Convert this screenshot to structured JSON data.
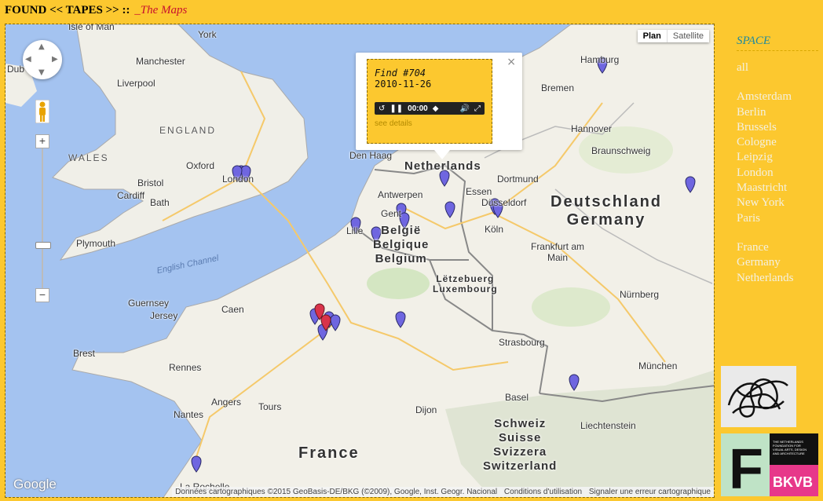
{
  "header": {
    "title": "FOUND << TAPES >> ::",
    "subtitle": "_The Maps"
  },
  "map": {
    "type_buttons": [
      {
        "label": "Plan",
        "active": true
      },
      {
        "label": "Satellite",
        "active": false
      }
    ],
    "countries": {
      "england": "ENGLAND",
      "wales": "WALES",
      "netherlands": "Netherlands",
      "belgium": [
        "België",
        "Belgique",
        "Belgium"
      ],
      "germany": [
        "Deutschland",
        "Germany"
      ],
      "luxembourg": [
        "Lëtzebuerg",
        "Luxembourg"
      ],
      "france": "France",
      "switzerland": [
        "Schweiz",
        "Suisse",
        "Svizzera",
        "Switzerland"
      ],
      "liechtenstein": "Liechtenstein"
    },
    "sea": "English Channel",
    "cities": [
      "York",
      "Isle of Man",
      "Manchester",
      "Liverpool",
      "Dub",
      "Oxford",
      "London",
      "Bristol",
      "Cardiff",
      "Bath",
      "Plymouth",
      "Guernsey",
      "Jersey",
      "Caen",
      "Brest",
      "Rennes",
      "Angers",
      "Tours",
      "Nantes",
      "La Rochelle",
      "Dijon",
      "Strasbourg",
      "Basel",
      "Nürnberg",
      "München",
      "Frankfurt am Main",
      "Köln",
      "Düsseldorf",
      "Essen",
      "Dortmund",
      "Hannover",
      "Braunschweig",
      "Bremen",
      "Hamburg",
      "Antwerpen",
      "Gent",
      "Lille",
      "Den Haag"
    ],
    "google_logo": "Google",
    "attribution": [
      "Données cartographiques ©2015 GeoBasis-DE/BKG (©2009), Google, Inst. Geogr. Nacional",
      "Conditions d'utilisation",
      "Signaler une erreur cartographique"
    ],
    "zoom_in": "+",
    "zoom_out": "−"
  },
  "popup": {
    "title": "Find #704",
    "date": "2010-11-26",
    "time": "00:00",
    "link": "see details",
    "close": "×"
  },
  "sidebar": {
    "heading": "SPACE",
    "all": "all",
    "cities": [
      "Amsterdam",
      "Berlin",
      "Brussels",
      "Cologne",
      "Leipzig",
      "London",
      "Maastricht",
      "New York",
      "Paris"
    ],
    "countries": [
      "France",
      "Germany",
      "Netherlands"
    ]
  },
  "logo": {
    "letter": "F",
    "caption": "THE NETHERLANDS FOUNDATION FOR VISUAL ARTS, DESIGN AND ARCHITECTURE",
    "brand": "BKVB"
  },
  "colors": {
    "background": "#fcc82f",
    "marker_blue": "#6f66e0",
    "marker_red": "#d9334a",
    "sidebar_link": "#f4f0e0",
    "sidebar_heading": "#1e8a9e"
  },
  "icons": {
    "pan": "pan-control-icon",
    "pegman": "street-view-pegman-icon",
    "marker": "map-marker-icon",
    "close": "close-icon"
  }
}
